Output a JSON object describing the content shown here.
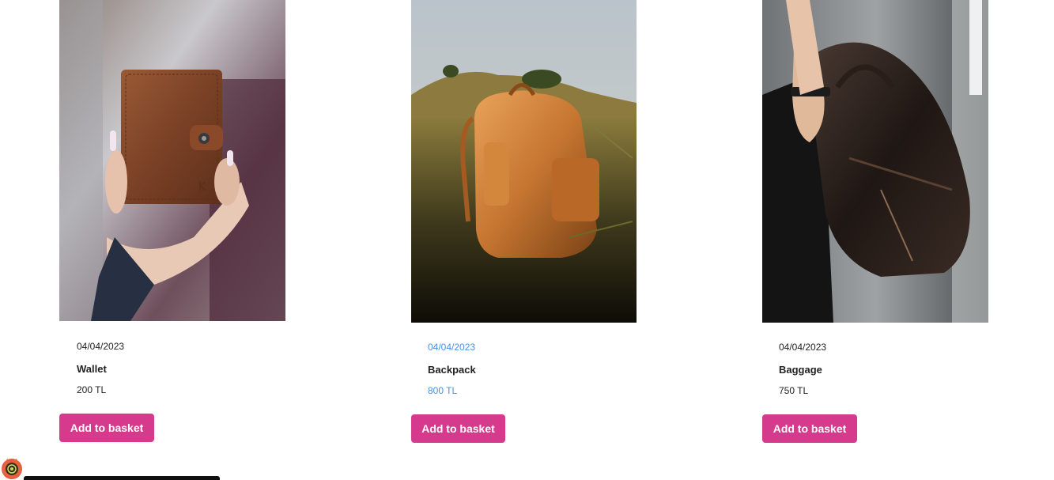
{
  "products": [
    {
      "image_alt": "Wallet",
      "date": "04/04/2023",
      "name": "Wallet",
      "price": "200 TL",
      "button_label": "Add to basket"
    },
    {
      "image_alt": "Backpack",
      "date": "04/04/2023",
      "name": "Backpack",
      "price": "800 TL",
      "button_label": "Add to basket"
    },
    {
      "image_alt": "Baggage",
      "date": "04/04/2023",
      "name": "Baggage",
      "price": "750 TL",
      "button_label": "Add to basket"
    }
  ],
  "colors": {
    "button_bg": "#d63a8c",
    "button_text": "#ffffff",
    "highlight_text": "#4a90e2",
    "body_text": "#222222"
  },
  "icons": {
    "devtools": "react-devtools-icon"
  }
}
